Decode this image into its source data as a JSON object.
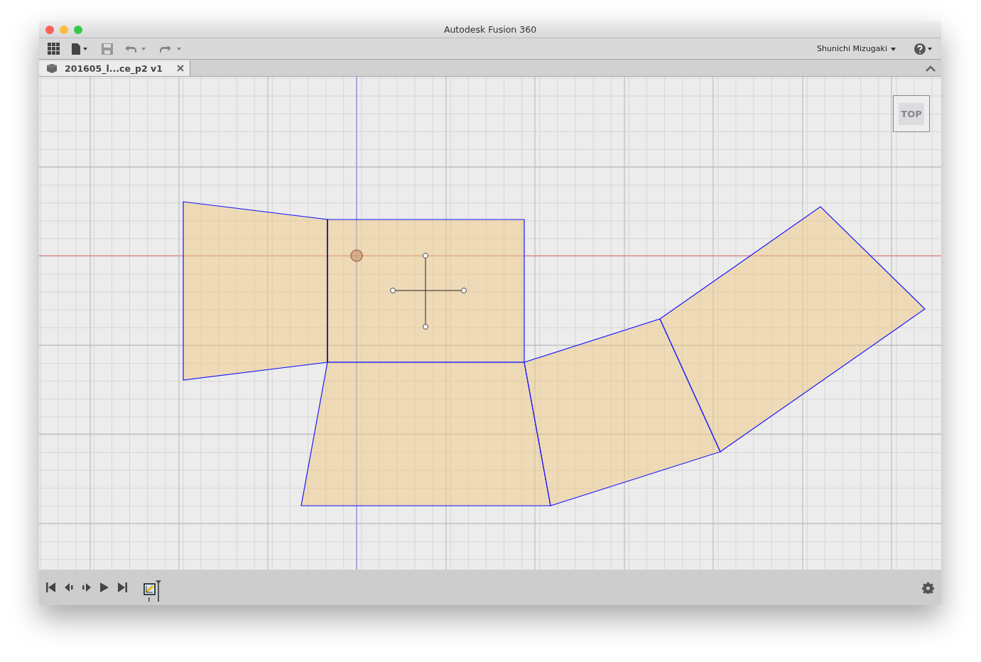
{
  "window": {
    "title": "Autodesk Fusion 360"
  },
  "toolbar": {
    "user": "Shunichi Mizugaki"
  },
  "tabs": [
    {
      "label": "201605_l...ce_p2 v1",
      "selected": true
    }
  ],
  "view_cube": {
    "face": "TOP"
  }
}
